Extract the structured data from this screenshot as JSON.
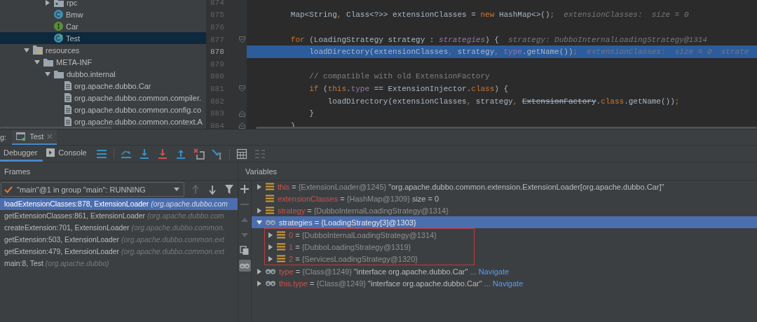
{
  "project_tree": {
    "package_items": [
      {
        "label": "rpc",
        "kind": "package",
        "expanded": false,
        "selected": false
      },
      {
        "label": "Bmw",
        "kind": "class",
        "selected": false
      },
      {
        "label": "Car",
        "kind": "interface",
        "selected": false
      },
      {
        "label": "Test",
        "kind": "main-class",
        "selected": true
      }
    ],
    "items": [
      {
        "label": "resources",
        "kind": "resources",
        "expanded": true,
        "selected": false,
        "children": [
          {
            "label": "META-INF",
            "kind": "folder",
            "expanded": true,
            "selected": false,
            "children": [
              {
                "label": "dubbo.internal",
                "kind": "folder",
                "expanded": true,
                "selected": false,
                "children": [
                  {
                    "label": "org.apache.dubbo.Car",
                    "kind": "file",
                    "selected": false
                  },
                  {
                    "label": "org.apache.dubbo.common.compiler.",
                    "kind": "file",
                    "selected": false
                  },
                  {
                    "label": "org.apache.dubbo.common.config.co",
                    "kind": "file",
                    "selected": false
                  },
                  {
                    "label": "org.apache.dubbo.common.context.A",
                    "kind": "file",
                    "selected": false
                  }
                ]
              }
            ]
          }
        ]
      }
    ]
  },
  "editor": {
    "lines": [
      {
        "number": "874",
        "selected": false,
        "kind": "plain"
      },
      {
        "number": "875",
        "selected": false,
        "kind": "plain",
        "tokens": [
          {
            "kind": "plain",
            "text": "        Map<String"
          },
          {
            "kind": "keyword",
            "text": ","
          },
          {
            "kind": "plain",
            "text": " Class<?>> extensionClasses = "
          },
          {
            "kind": "keyword",
            "text": "new"
          },
          {
            "kind": "plain",
            "text": " HashMap<>()"
          },
          {
            "kind": "keyword",
            "text": ";"
          },
          {
            "kind": "hint",
            "text": "  extensionClasses:  size = 0"
          }
        ]
      },
      {
        "number": "876",
        "selected": false,
        "kind": "plain"
      },
      {
        "number": "877",
        "selected": false,
        "kind": "block-start",
        "tokens": [
          {
            "kind": "keyword",
            "text": "        for"
          },
          {
            "kind": "plain",
            "text": " (LoadingStrategy strategy : "
          },
          {
            "kind": "static-field",
            "text": "strategies"
          },
          {
            "kind": "plain",
            "text": ") {"
          },
          {
            "kind": "hint",
            "text": "  strategy: DubboInternalLoadingStrategy@1314"
          }
        ]
      },
      {
        "number": "878",
        "selected": true,
        "kind": "plain",
        "tokens": [
          {
            "kind": "plain",
            "text": "            loadDirectory(extensionClasses"
          },
          {
            "kind": "keyword",
            "text": ","
          },
          {
            "kind": "plain",
            "text": " strategy"
          },
          {
            "kind": "keyword",
            "text": ", "
          },
          {
            "kind": "field",
            "text": "type"
          },
          {
            "kind": "plain",
            "text": ".getName())"
          },
          {
            "kind": "keyword",
            "text": ";"
          },
          {
            "kind": "hint",
            "text": "  extensionClasses:  size = 0  strate"
          }
        ]
      },
      {
        "number": "879",
        "selected": false,
        "kind": "plain"
      },
      {
        "number": "880",
        "selected": false,
        "kind": "plain",
        "tokens": [
          {
            "kind": "comment",
            "text": "            // compatible with old ExtensionFactory"
          }
        ]
      },
      {
        "number": "881",
        "selected": false,
        "kind": "block-start",
        "tokens": [
          {
            "kind": "keyword",
            "text": "            if"
          },
          {
            "kind": "plain",
            "text": " ("
          },
          {
            "kind": "keyword",
            "text": "this"
          },
          {
            "kind": "plain",
            "text": "."
          },
          {
            "kind": "field",
            "text": "type"
          },
          {
            "kind": "plain",
            "text": " == ExtensionInjector."
          },
          {
            "kind": "keyword",
            "text": "class"
          },
          {
            "kind": "plain",
            "text": ") {"
          }
        ]
      },
      {
        "number": "882",
        "selected": false,
        "kind": "plain",
        "tokens": [
          {
            "kind": "plain",
            "text": "                loadDirectory(extensionClasses"
          },
          {
            "kind": "keyword",
            "text": ","
          },
          {
            "kind": "plain",
            "text": " strategy"
          },
          {
            "kind": "keyword",
            "text": ", "
          },
          {
            "kind": "deprecated",
            "text": "ExtensionFactory"
          },
          {
            "kind": "plain",
            "text": "."
          },
          {
            "kind": "keyword",
            "text": "class"
          },
          {
            "kind": "plain",
            "text": ".getName())"
          },
          {
            "kind": "keyword",
            "text": ";"
          }
        ]
      },
      {
        "number": "883",
        "selected": false,
        "kind": "block-end",
        "tokens": [
          {
            "kind": "plain",
            "text": "            }"
          }
        ]
      },
      {
        "number": "884",
        "selected": false,
        "kind": "block-end",
        "tokens": [
          {
            "kind": "plain",
            "text": "        }"
          }
        ]
      }
    ]
  },
  "debug": {
    "window_label": "g:",
    "session_tabs": [
      {
        "label": "Test",
        "selected": true
      }
    ],
    "view_tabs": [
      {
        "label": "Debugger",
        "kind": "debugger",
        "selected": true
      },
      {
        "label": "Console",
        "kind": "console",
        "selected": false
      }
    ],
    "toolbar": [
      {
        "kind": "show-execution-point",
        "disabled": false
      },
      {
        "kind": "step-over",
        "disabled": false
      },
      {
        "kind": "step-into",
        "disabled": false
      },
      {
        "kind": "force-step-into",
        "disabled": false
      },
      {
        "kind": "step-out",
        "disabled": false
      },
      {
        "kind": "drop-frame",
        "disabled": false
      },
      {
        "kind": "run-to-cursor",
        "disabled": false
      },
      {
        "kind": "evaluate",
        "disabled": false
      },
      {
        "kind": "trace",
        "disabled": true
      }
    ],
    "frames": {
      "title": "Frames",
      "thread": "\"main\"@1 in group \"main\": RUNNING",
      "nav": [
        {
          "kind": "up",
          "disabled": true
        },
        {
          "kind": "down",
          "disabled": false
        },
        {
          "kind": "filter",
          "disabled": false
        }
      ],
      "rows": [
        {
          "method": "loadExtensionClasses:878, ExtensionLoader",
          "package": "(org.apache.dubbo.com",
          "selected": true
        },
        {
          "method": "getExtensionClasses:861, ExtensionLoader",
          "package": "(org.apache.dubbo.com",
          "selected": false
        },
        {
          "method": "createExtension:701, ExtensionLoader",
          "package": "(org.apache.dubbo.common.",
          "selected": false
        },
        {
          "method": "getExtension:503, ExtensionLoader",
          "package": "(org.apache.dubbo.common.ext",
          "selected": false
        },
        {
          "method": "getExtension:479, ExtensionLoader",
          "package": "(org.apache.dubbo.common.ext",
          "selected": false
        },
        {
          "method": "main:8, Test",
          "package": "(org.apache.dubbo)",
          "selected": false
        }
      ]
    },
    "variables": {
      "title": "Variables",
      "side_toolbar": [
        {
          "kind": "add",
          "disabled": false
        },
        {
          "kind": "remove",
          "disabled": true
        },
        {
          "kind": "up",
          "disabled": true
        },
        {
          "kind": "down",
          "disabled": true
        },
        {
          "kind": "copy",
          "disabled": false
        },
        {
          "kind": "watches",
          "disabled": false,
          "on": true
        }
      ],
      "items": [
        {
          "kind": "field",
          "name": "this",
          "operator": "=",
          "type_id": "{ExtensionLoader@1245}",
          "value": "\"org.apache.dubbo.common.extension.ExtensionLoader[org.apache.dubbo.Car]\"",
          "expanded": false,
          "selected": false
        },
        {
          "kind": "field",
          "name": "extensionClasses",
          "operator": "=",
          "type_id": "{HashMap@1309}",
          "value": "size = 0",
          "selected": false
        },
        {
          "kind": "field",
          "name": "strategy",
          "operator": "=",
          "type_id": "{DubboInternalLoadingStrategy@1314}",
          "expanded": false,
          "selected": false
        },
        {
          "kind": "watch",
          "name": "strategies",
          "operator": "=",
          "type_id": "{LoadingStrategy[3]@1303}",
          "expanded": true,
          "selected": true,
          "boxed": true,
          "children": [
            {
              "kind": "field",
              "name": "0",
              "operator": "=",
              "type_id": "{DubboInternalLoadingStrategy@1314}",
              "expanded": false,
              "selected": false
            },
            {
              "kind": "field",
              "name": "1",
              "operator": "=",
              "type_id": "{DubboLoadingStrategy@1319}",
              "expanded": false,
              "selected": false
            },
            {
              "kind": "field",
              "name": "2",
              "operator": "=",
              "type_id": "{ServicesLoadingStrategy@1320}",
              "expanded": false,
              "selected": false
            }
          ]
        },
        {
          "kind": "watch",
          "name": "type",
          "operator": "=",
          "type_id": "{Class@1249}",
          "value": "\"interface org.apache.dubbo.Car\"",
          "link": "... Navigate",
          "expanded": false,
          "selected": false
        },
        {
          "kind": "watch",
          "name": "this.type",
          "operator": "=",
          "type_id": "{Class@1249}",
          "value": "\"interface org.apache.dubbo.Car\"",
          "link": "... Navigate",
          "expanded": false,
          "selected": false
        }
      ]
    }
  }
}
